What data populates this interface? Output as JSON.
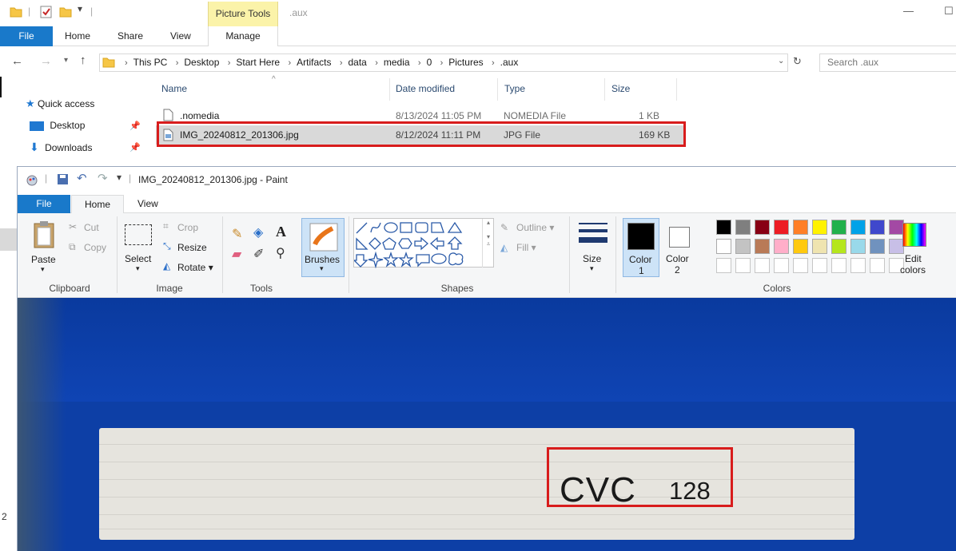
{
  "explorer": {
    "context_tab": "Picture Tools",
    "window_title": ".aux",
    "tabs": [
      "File",
      "Home",
      "Share",
      "View",
      "Manage"
    ],
    "breadcrumb": [
      "This PC",
      "Desktop",
      "Start Here",
      "Artifacts",
      "data",
      "media",
      "0",
      "Pictures",
      ".aux"
    ],
    "search_placeholder": "Search .aux",
    "nav": [
      "Quick access",
      "Desktop",
      "Downloads"
    ],
    "columns": [
      "Name",
      "Date modified",
      "Type",
      "Size"
    ],
    "files": [
      {
        "name": ".nomedia",
        "date": "8/13/2024 11:05 PM",
        "type": "NOMEDIA File",
        "size": "1 KB"
      },
      {
        "name": "IMG_20240812_201306.jpg",
        "date": "8/12/2024 11:11 PM",
        "type": "JPG File",
        "size": "169 KB"
      }
    ],
    "left_edge_digit": "2"
  },
  "paint": {
    "title": "IMG_20240812_201306.jpg - Paint",
    "tabs": [
      "File",
      "Home",
      "View"
    ],
    "clipboard": {
      "paste": "Paste",
      "cut": "Cut",
      "copy": "Copy",
      "label": "Clipboard"
    },
    "image": {
      "select": "Select",
      "crop": "Crop",
      "resize": "Resize",
      "rotate": "Rotate",
      "label": "Image"
    },
    "tools": {
      "label": "Tools",
      "text": "A"
    },
    "brushes": "Brushes",
    "shapes": {
      "outline": "Outline",
      "fill": "Fill",
      "label": "Shapes"
    },
    "size": "Size",
    "color1": {
      "line1": "Color",
      "line2": "1"
    },
    "color2": {
      "line1": "Color",
      "line2": "2"
    },
    "colors_label": "Colors",
    "edit_colors": {
      "line1": "Edit",
      "line2": "colors"
    },
    "palette_row1": [
      "#000000",
      "#7f7f7f",
      "#880015",
      "#ed1c24",
      "#ff7f27",
      "#fff200",
      "#22b14c",
      "#00a2e8",
      "#3f48cc",
      "#a349a4"
    ],
    "palette_row2": [
      "#ffffff",
      "#c3c3c3",
      "#b97a57",
      "#ffaec9",
      "#ffc90e",
      "#efe4b0",
      "#b5e61d",
      "#99d9ea",
      "#7092be",
      "#c8bfe7"
    ],
    "color1_value": "#000000",
    "color2_value": "#ffffff"
  },
  "photo": {
    "cvc_label": "CVC",
    "cvc_value": "128"
  },
  "highlight_color": "#d81c1c"
}
